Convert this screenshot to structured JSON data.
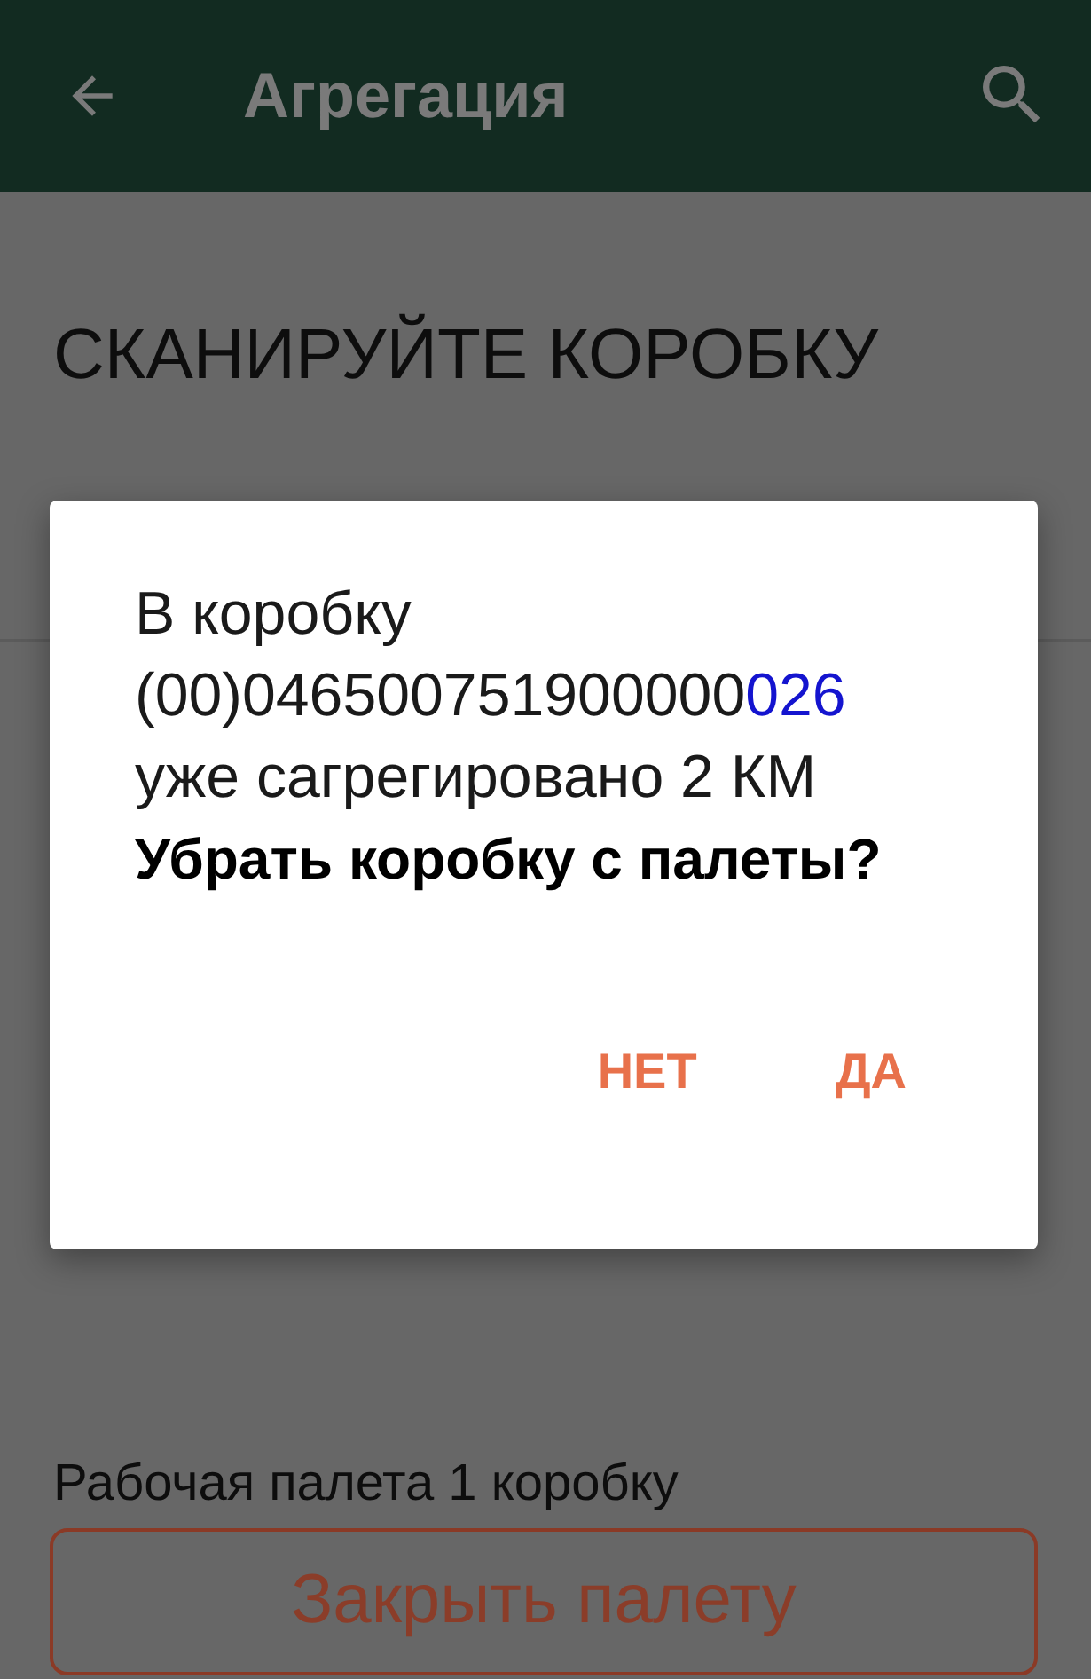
{
  "app_bar": {
    "title": "Агрегация"
  },
  "screen": {
    "heading": "СКАНИРУЙТЕ КОРОБКУ",
    "pallet_status": "Рабочая палета 1 коробку",
    "close_button": {
      "label": "Закрыть палету"
    }
  },
  "dialog": {
    "message": {
      "intro": "В коробку",
      "box_code": "(00)046500751900000",
      "box_code_tail": "026",
      "result": "уже сагрегировано 2 КМ"
    },
    "question": "Убрать коробку с палеты?",
    "buttons": [
      {
        "label": "НЕТ"
      },
      {
        "label": "ДА"
      }
    ]
  }
}
